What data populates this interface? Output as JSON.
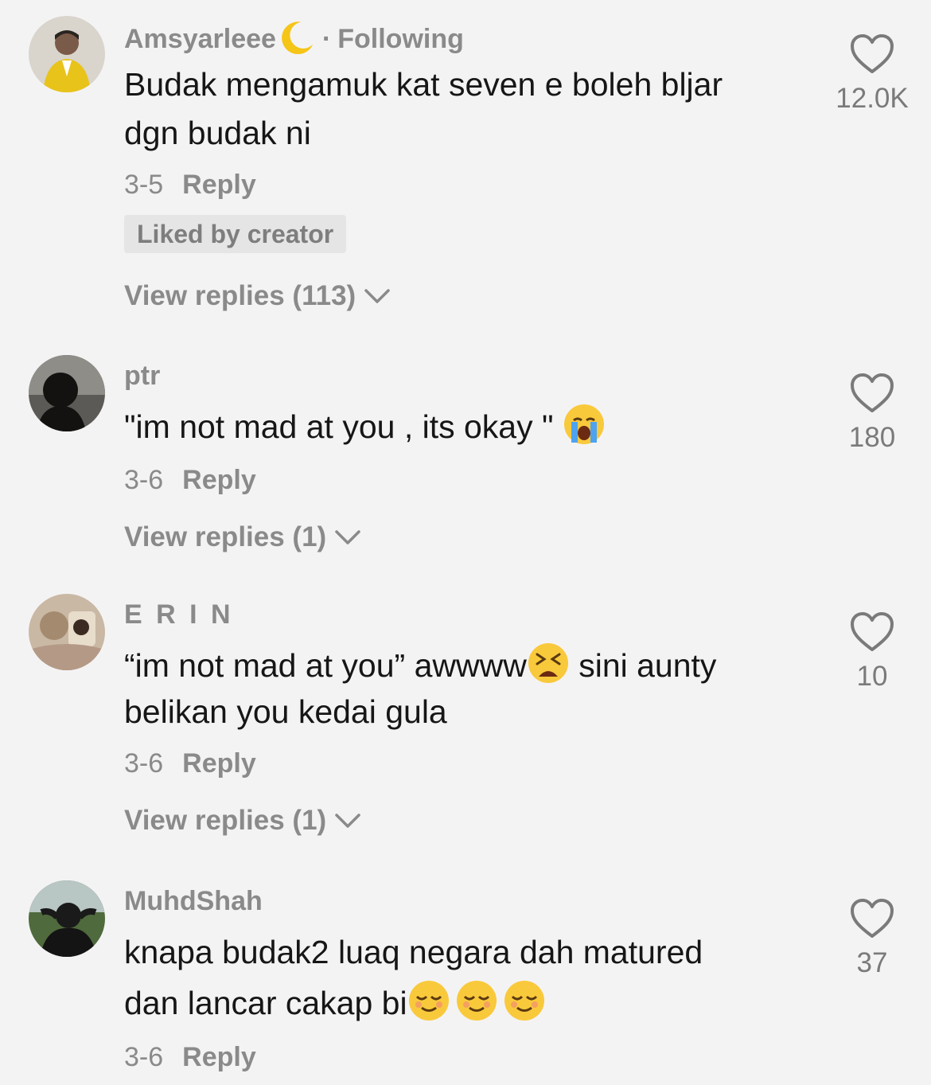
{
  "comments": [
    {
      "username": "Amsyarleee",
      "username_emoji": "moon-emoji",
      "separator": "·",
      "following": "Following",
      "text_lines": [
        "Budak mengamuk kat seven e boleh bljar",
        "dgn budak ni"
      ],
      "date": "3-5",
      "reply": "Reply",
      "liked_badge": "Liked by creator",
      "view_replies": "View replies (113)",
      "likes": "12.0K"
    },
    {
      "username": "ptr",
      "text": "\"im not mad at you , its okay \"",
      "emoji": "loudly-crying-emoji",
      "date": "3-6",
      "reply": "Reply",
      "view_replies": "View replies (1)",
      "likes": "180"
    },
    {
      "username": "E R I N",
      "text_line1_a": "“im not mad at you” awwww",
      "emoji": "tired-face-emoji",
      "text_line1_b": " sini aunty",
      "text_line2": "belikan you kedai gula",
      "date": "3-6",
      "reply": "Reply",
      "view_replies": "View replies (1)",
      "likes": "10"
    },
    {
      "username": "MuhdShah",
      "text_line1": "knapa budak2 luaq negara dah matured",
      "text_line2": "dan lancar cakap bi",
      "emojis": [
        "relieved-face-emoji",
        "relieved-face-emoji",
        "relieved-face-emoji"
      ],
      "date": "3-6",
      "reply": "Reply",
      "likes": "37"
    }
  ],
  "colors": {
    "background": "#f4f3f4",
    "text_primary": "#161616",
    "text_secondary": "#8a8a8a",
    "badge_bg": "#e6e5e6"
  }
}
